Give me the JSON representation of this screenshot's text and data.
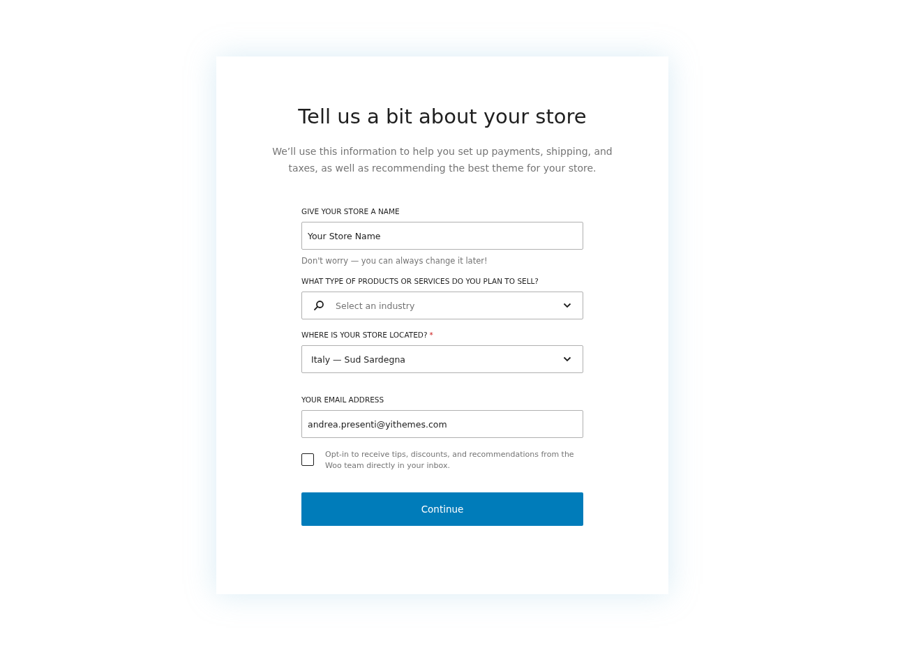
{
  "title": "Tell us a bit about your store",
  "subtitle": "We’ll use this information to help you set up payments, shipping, and taxes, as well as recommending the best theme for your store.",
  "fields": [
    {
      "kind": "text",
      "label": "GIVE YOUR STORE A NAME",
      "value": "Your Store Name",
      "help": "Don't worry — you can always change it later!"
    },
    {
      "kind": "search-select",
      "label": "WHAT TYPE OF PRODUCTS OR SERVICES DO YOU PLAN TO SELL?",
      "placeholder": "Select an industry"
    },
    {
      "kind": "select",
      "label": "WHERE IS YOUR STORE LOCATED?",
      "required_mark": "*",
      "value": "Italy — Sud Sardegna"
    },
    {
      "kind": "text",
      "label": "YOUR EMAIL ADDRESS",
      "value": "andrea.presenti@yithemes.com"
    }
  ],
  "opt_in": {
    "checked": false,
    "label": "Opt-in to receive tips, discounts, and recommendations from the Woo team directly in your inbox."
  },
  "button": "Continue"
}
